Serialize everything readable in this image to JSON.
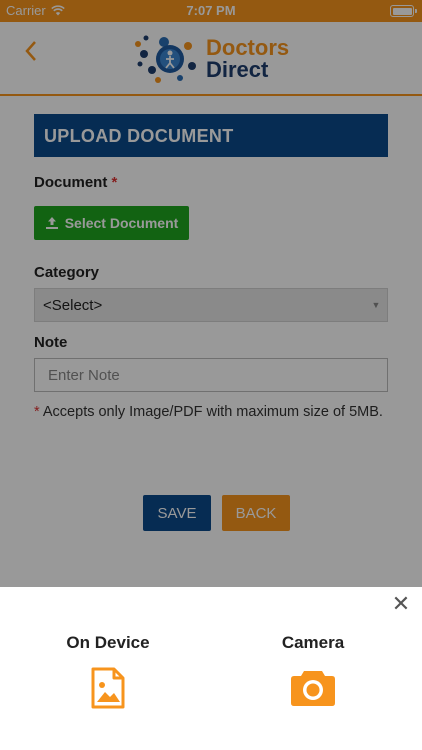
{
  "status_bar": {
    "carrier": "Carrier",
    "time": "7:07 PM"
  },
  "header": {
    "logo_line1": "Doctors",
    "logo_line2": "Direct"
  },
  "form": {
    "title": "UPLOAD DOCUMENT",
    "document_label": "Document",
    "required_mark": "*",
    "select_document_label": "Select Document",
    "category_label": "Category",
    "category_value": "<Select>",
    "note_label": "Note",
    "note_placeholder": "Enter Note",
    "hint_mark": "*",
    "hint_text": "Accepts only Image/PDF with maximum size of 5MB.",
    "save_label": "SAVE",
    "back_label": "BACK"
  },
  "sheet": {
    "close_icon": "close-icon",
    "options": [
      {
        "label": "On Device",
        "icon": "image-file-icon"
      },
      {
        "label": "Camera",
        "icon": "camera-icon"
      }
    ]
  },
  "colors": {
    "primary_orange": "#f7941d",
    "primary_blue": "#0a4a8a",
    "success_green": "#1ea51e"
  }
}
